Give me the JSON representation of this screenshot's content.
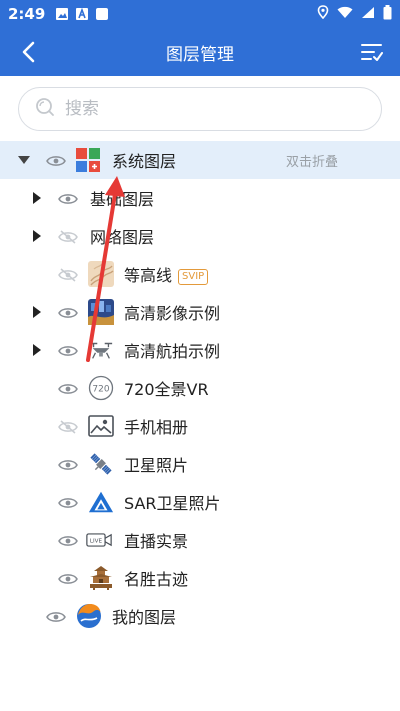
{
  "status": {
    "time": "2:49"
  },
  "appbar": {
    "title": "图层管理"
  },
  "search": {
    "placeholder": "搜索"
  },
  "tree": {
    "system": {
      "label": "系统图层",
      "hint": "双击折叠"
    },
    "basic": {
      "label": "基础图层"
    },
    "network": {
      "label": "网络图层"
    },
    "contour": {
      "label": "等高线",
      "badge": "SVIP"
    },
    "hd": {
      "label": "高清影像示例"
    },
    "aerial": {
      "label": "高清航拍示例"
    },
    "vr": {
      "label": "720全景VR",
      "icon_text": "720"
    },
    "album": {
      "label": "手机相册"
    },
    "satellite": {
      "label": "卫星照片"
    },
    "sar": {
      "label": "SAR卫星照片"
    },
    "live": {
      "label": "直播实景",
      "icon_text": "LIVE"
    },
    "heritage": {
      "label": "名胜古迹"
    },
    "mine": {
      "label": "我的图层"
    }
  },
  "colors": {
    "primary": "#2f6fd6",
    "highlight": "#e3eefa",
    "arrow": "#e53935"
  }
}
